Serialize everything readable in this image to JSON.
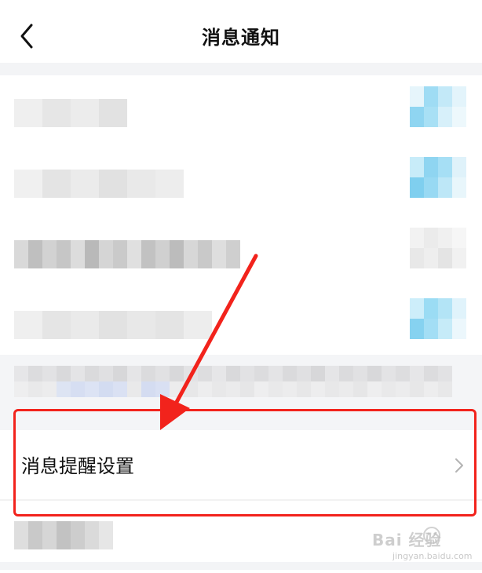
{
  "header": {
    "title": "消息通知",
    "back_icon": "chevron-left-icon"
  },
  "reminder_settings": {
    "label": "消息提醒设置",
    "chevron_icon": "chevron-right-icon"
  },
  "annotation": {
    "box_color": "#f2231c",
    "arrow_color": "#f2231c"
  },
  "watermark": {
    "brand": "Bai 经验",
    "url": "jingyan.baidu.com"
  }
}
